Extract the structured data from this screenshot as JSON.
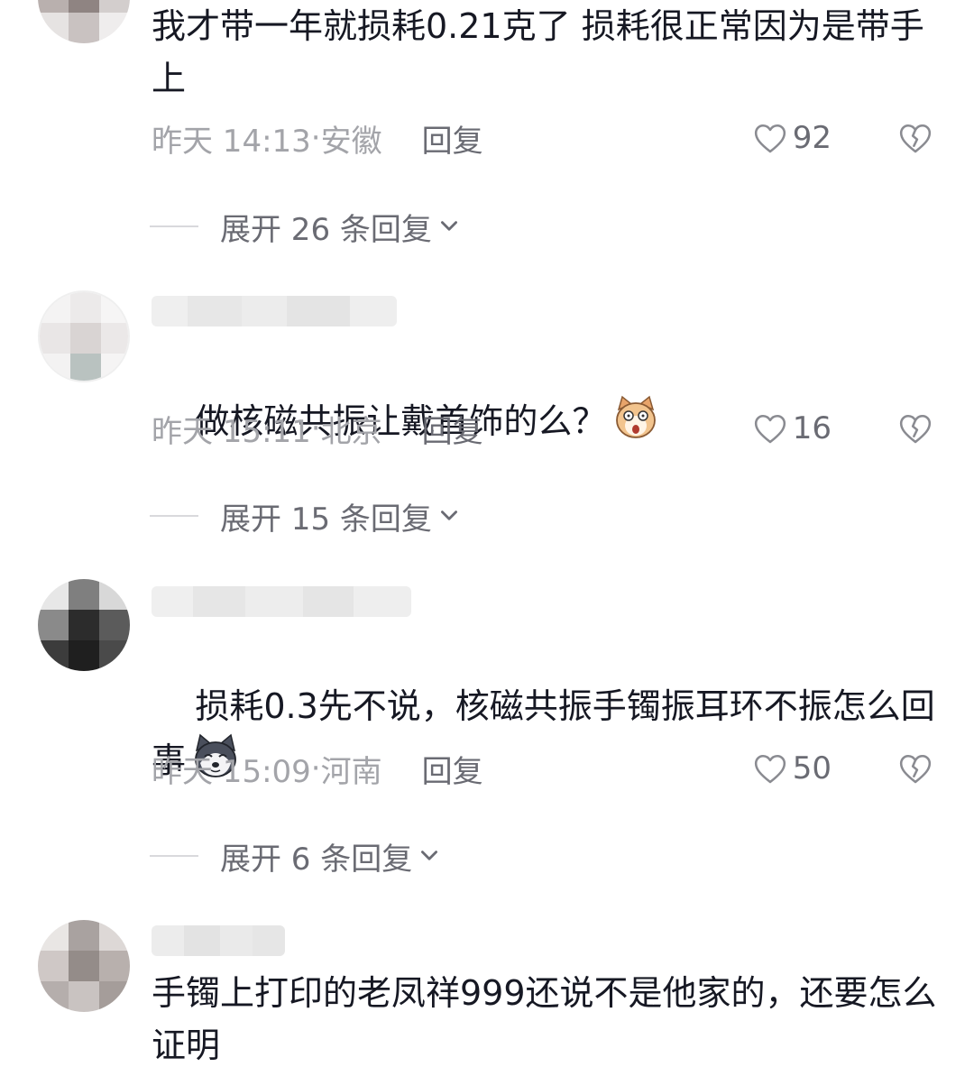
{
  "comments": [
    {
      "text": "我才带一年就损耗0.21克了 损耗很正常因为是带手上",
      "time": "昨天 14:13",
      "location": "安徽",
      "reply_label": "回复",
      "likes": "92",
      "expand_label": "展开 26 条回复"
    },
    {
      "text": "做核磁共振让戴首饰的么？",
      "emoji": "shocked-dog-emoji",
      "time": "昨天 15:11",
      "location": "北京",
      "reply_label": "回复",
      "likes": "16",
      "expand_label": "展开 15 条回复"
    },
    {
      "text": "损耗0.3先不说，核磁共振手镯振耳环不振怎么回事",
      "emoji": "husky-emoji",
      "time": "昨天 15:09",
      "location": "河南",
      "reply_label": "回复",
      "likes": "50",
      "expand_label": "展开 6 条回复"
    },
    {
      "text": "手镯上打印的老凤祥999还说不是他家的，还要怎么证明"
    }
  ],
  "meta_separator": "·",
  "colors": {
    "text": "#161823",
    "meta": "#a3a4a9",
    "secondary": "#6a6b73",
    "divider": "#d9d9dc"
  },
  "icons": {
    "like": "heart-outline-icon",
    "dislike": "broken-heart-icon",
    "expand": "chevron-down-icon"
  }
}
